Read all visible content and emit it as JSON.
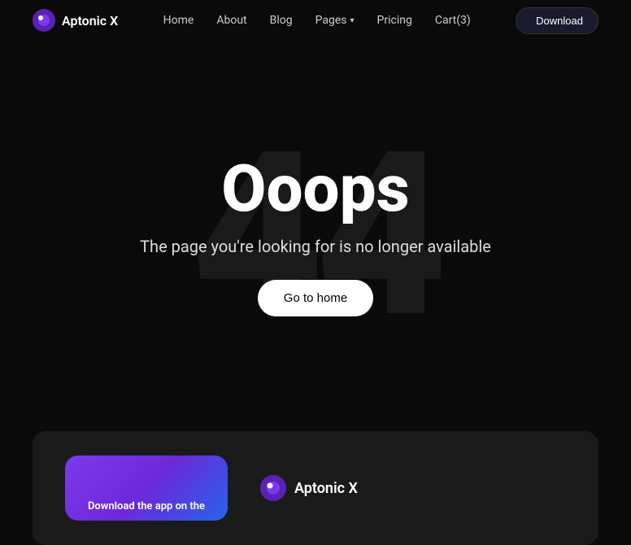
{
  "brand": {
    "name": "Aptonic X"
  },
  "navbar": {
    "links": [
      {
        "label": "Home",
        "id": "home"
      },
      {
        "label": "About",
        "id": "about"
      },
      {
        "label": "Blog",
        "id": "blog"
      },
      {
        "label": "Pages",
        "id": "pages",
        "hasDropdown": true
      },
      {
        "label": "Pricing",
        "id": "pricing"
      },
      {
        "label": "Cart(3)",
        "id": "cart"
      }
    ],
    "download_label": "Download"
  },
  "hero": {
    "bg_numbers": [
      "4",
      "4"
    ],
    "title": "Ooops",
    "subtitle": "The page you're looking for is no longer available",
    "cta_label": "Go to home"
  },
  "footer_card": {
    "app_text": "Download the app on the",
    "brand_name": "Aptonic X"
  },
  "icons": {
    "apple": "",
    "chevron_down": "▾"
  }
}
